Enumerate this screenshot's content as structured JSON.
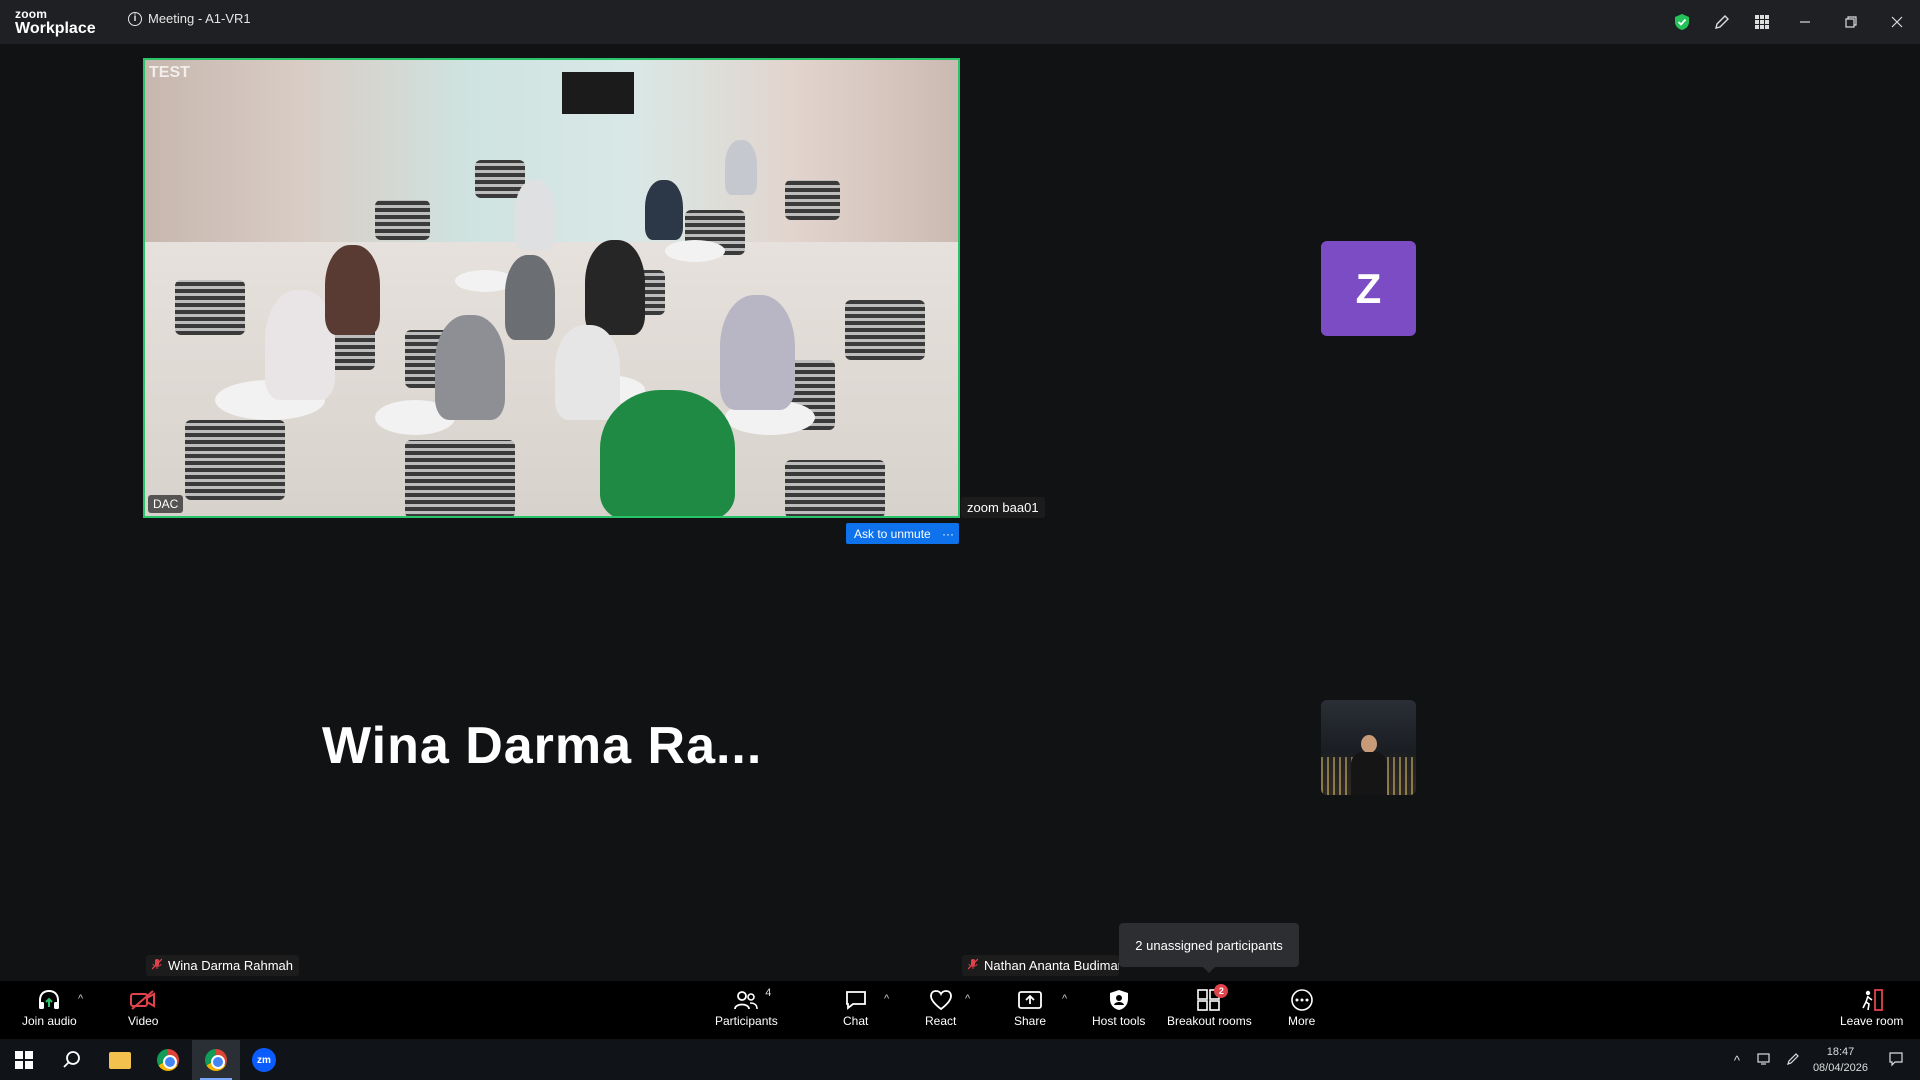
{
  "titlebar": {
    "brand_top": "zoom",
    "brand_bottom": "Workplace",
    "meeting_title": "Meeting - A1-VR1"
  },
  "main_video": {
    "watermark": "TEST",
    "corner_label": "DAC",
    "participant_name": "zoom baa01",
    "ask_unmute_label": "Ask to unmute",
    "more_label": "···"
  },
  "tiles": {
    "avatar_letter": "Z",
    "big_name": "Wina Darma Ra...",
    "name_tag_left": "Wina Darma Rahmah",
    "name_tag_right": "Nathan Ananta Budiman"
  },
  "tooltip": {
    "text": "2 unassigned participants"
  },
  "toolbar": {
    "join_audio": "Join audio",
    "video": "Video",
    "participants": "Participants",
    "participants_count": "4",
    "chat": "Chat",
    "react": "React",
    "share": "Share",
    "host_tools": "Host tools",
    "breakout_rooms": "Breakout rooms",
    "breakout_badge": "2",
    "more": "More",
    "leave_room": "Leave room"
  },
  "taskbar": {
    "zoom_app_label": "zm",
    "time": "18:47",
    "date": "08/04/2026"
  },
  "colors": {
    "active_speaker_border": "#29c46a",
    "avatar_bg": "#7b4cc4",
    "primary_blue": "#0e72ed",
    "mute_red": "#e0434b"
  }
}
